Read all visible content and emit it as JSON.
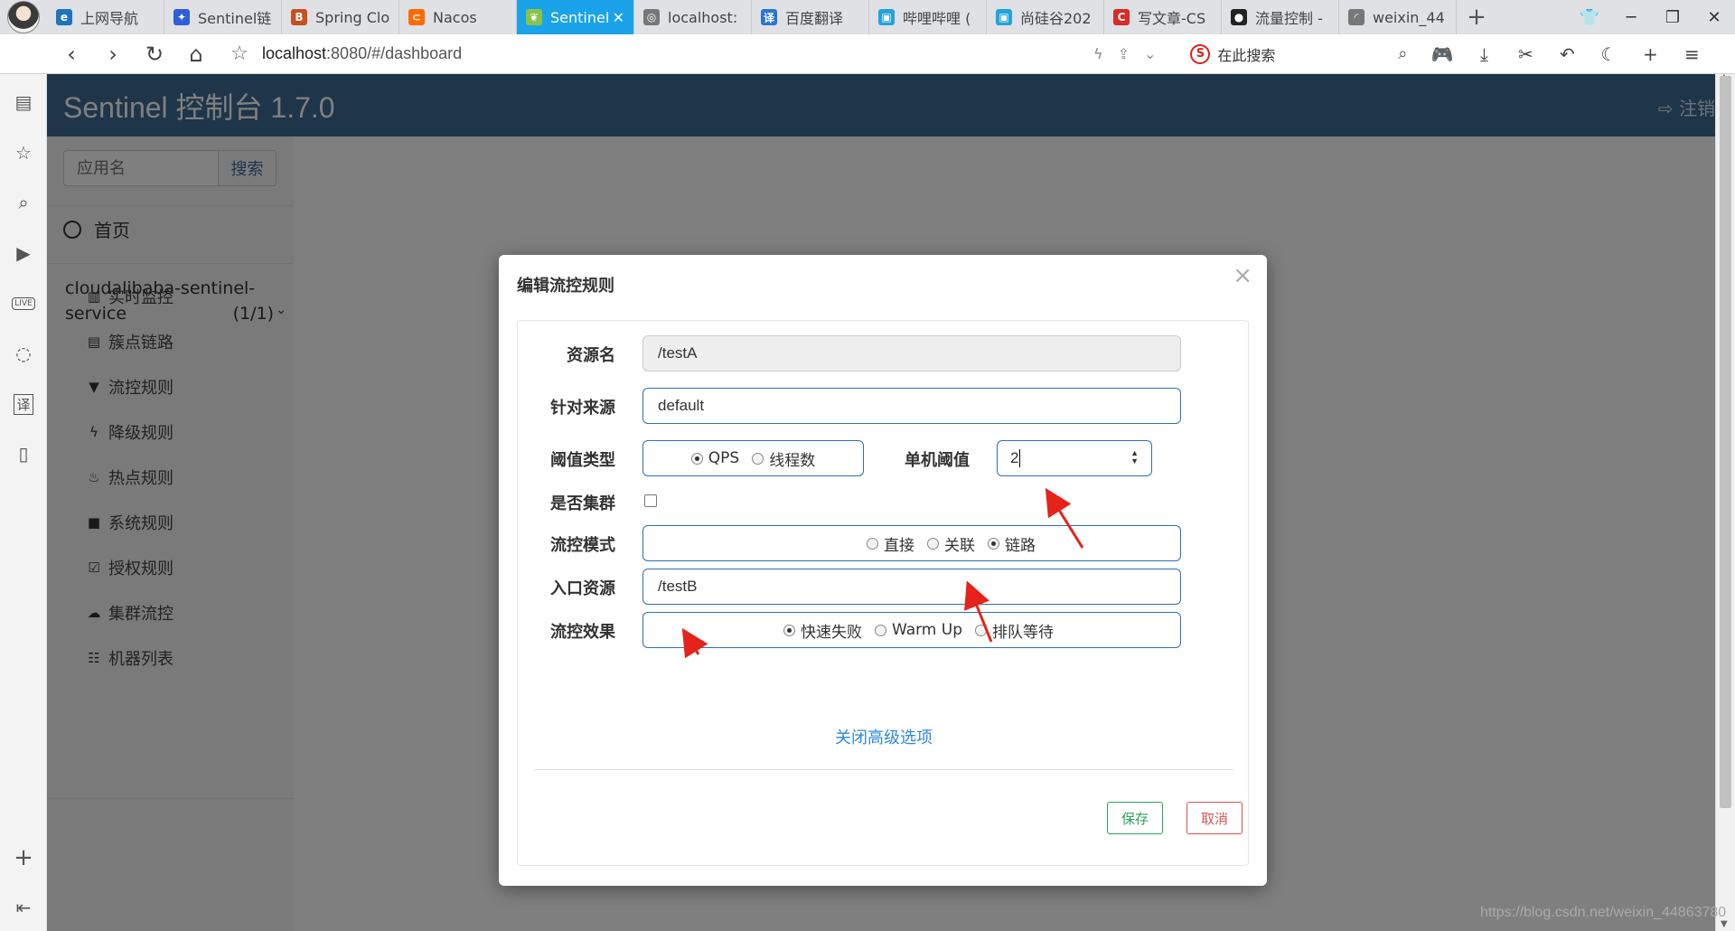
{
  "browser": {
    "tabs": [
      {
        "label": "上网导航",
        "icon": "ie-icon",
        "color": "#1e73be"
      },
      {
        "label": "Sentinel链",
        "icon": "baidu-paw-icon",
        "color": "#2f5fd6"
      },
      {
        "label": "Spring Clo",
        "icon": "b-logo-icon",
        "color": "#c8501c"
      },
      {
        "label": "Nacos",
        "icon": "nacos-icon",
        "color": "#ff6a00"
      },
      {
        "label": "Sentinel",
        "icon": "leaf-icon",
        "color": "#8bc34a"
      },
      {
        "label": "localhost:",
        "icon": "globe-icon",
        "color": "#777777"
      },
      {
        "label": "百度翻译",
        "icon": "translate-icon",
        "color": "#2a74d6"
      },
      {
        "label": "哔哩哔哩 (",
        "icon": "bilibili-icon",
        "color": "#23a3dd"
      },
      {
        "label": "尚硅谷202",
        "icon": "bilibili-icon",
        "color": "#23a3dd"
      },
      {
        "label": "写文章-CS",
        "icon": "csdn-icon",
        "color": "#d82a2a"
      },
      {
        "label": "流量控制 -",
        "icon": "github-icon",
        "color": "#222222"
      },
      {
        "label": "weixin_44",
        "icon": "spinner-icon",
        "color": "#777777"
      }
    ],
    "active_tab_close": "✕",
    "new_tab": "+",
    "url_host": "localhost",
    "url_rest": ":8080/#/dashboard",
    "search_placeholder": "在此搜索",
    "search_engine_logo": "S"
  },
  "app": {
    "title": "Sentinel 控制台 1.7.0",
    "logout_label": "注销",
    "header_color": "#3c6b94"
  },
  "sidebar": {
    "search_placeholder": "应用名",
    "search_button": "搜索",
    "home_label": "首页",
    "app_name": "cloudalibaba-sentinel-service",
    "app_name_line1": "cloudalibaba-sentinel-",
    "app_name_line2": "service",
    "app_count": "(1/1)",
    "menu": [
      {
        "label": "实时监控",
        "icon": "bar-chart-icon"
      },
      {
        "label": "簇点链路",
        "icon": "list-icon"
      },
      {
        "label": "流控规则",
        "icon": "filter-icon"
      },
      {
        "label": "降级规则",
        "icon": "bolt-icon"
      },
      {
        "label": "热点规则",
        "icon": "fire-icon"
      },
      {
        "label": "系统规则",
        "icon": "lock-icon"
      },
      {
        "label": "授权规则",
        "icon": "check-square-icon"
      },
      {
        "label": "集群流控",
        "icon": "cloud-icon"
      },
      {
        "label": "机器列表",
        "icon": "th-list-icon"
      }
    ]
  },
  "modal": {
    "title": "编辑流控规则",
    "close": "×",
    "fields": {
      "resource": {
        "label": "资源名",
        "value": "/testA"
      },
      "limit_app": {
        "label": "针对来源",
        "value": "default"
      },
      "grade": {
        "label": "阈值类型",
        "options": [
          "QPS",
          "线程数"
        ],
        "selected": "QPS"
      },
      "count": {
        "label": "单机阈值",
        "value": "2"
      },
      "cluster": {
        "label": "是否集群",
        "checked": false
      },
      "strategy": {
        "label": "流控模式",
        "options": [
          "直接",
          "关联",
          "链路"
        ],
        "selected": "链路"
      },
      "ref_resource": {
        "label": "入口资源",
        "value": "/testB"
      },
      "control_behavior": {
        "label": "流控效果",
        "options": [
          "快速失败",
          "Warm Up",
          "排队等待"
        ],
        "selected": "快速失败"
      }
    },
    "advanced_toggle": "关闭高级选项",
    "save_button": "保存",
    "cancel_button": "取消"
  },
  "watermark": "https://blog.csdn.net/weixin_44863780"
}
